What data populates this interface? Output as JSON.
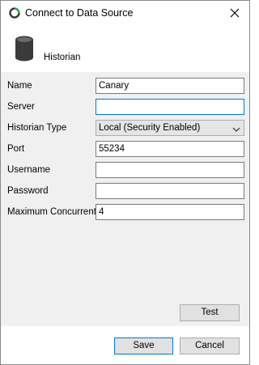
{
  "window": {
    "title": "Connect to Data Source"
  },
  "header": {
    "label": "Historian"
  },
  "form": {
    "name": {
      "label": "Name",
      "value": "Canary"
    },
    "server": {
      "label": "Server",
      "value": ""
    },
    "historian_type": {
      "label": "Historian Type",
      "selected": "Local (Security Enabled)"
    },
    "port": {
      "label": "Port",
      "value": "55234"
    },
    "username": {
      "label": "Username",
      "value": ""
    },
    "password": {
      "label": "Password",
      "value": ""
    },
    "max_concurrent": {
      "label": "Maximum Concurrent",
      "value": "4"
    }
  },
  "buttons": {
    "test": "Test",
    "save": "Save",
    "cancel": "Cancel"
  },
  "colors": {
    "focus_border": "#0078d7",
    "dialog_bg": "#f0f0f0",
    "icon_dark": "#3a3a3a",
    "icon_green": "#2e9e4a"
  },
  "icons": {
    "app": "circular-refresh-icon",
    "close": "close-icon",
    "header": "database-icon",
    "dropdown": "chevron-down-icon"
  }
}
